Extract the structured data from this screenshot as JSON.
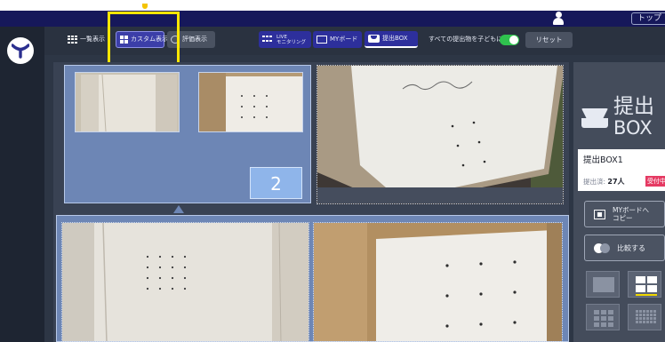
{
  "header": {
    "top_button": "トップ"
  },
  "toolbar": {
    "list_view_label": "一覧表示",
    "custom_view_label": "カスタム表示",
    "evaluation_view_label": "評価表示",
    "live_label_line1": "LIVE",
    "live_label_line2": "モニタリング",
    "myboard_label": "MYボード",
    "submit_box_label": "提出BOX",
    "publish_all_label": "すべての提出物を子どもに公開",
    "publish_all_enabled": true,
    "reset_label": "リセット"
  },
  "main": {
    "group_count": "2"
  },
  "side_panel": {
    "title_line1": "提出",
    "title_line2": "BOX",
    "box_name": "提出BOX1",
    "submitted_label": "提出済:",
    "submitted_count": "27人",
    "status_label": "受付中",
    "copy_button_line1": "MYボードへ",
    "copy_button_line2": "コピー",
    "compare_button": "比較する"
  },
  "colors": {
    "accent_blue": "#2d2f9c",
    "toggle_on": "#2fc24e",
    "status_red": "#e53a63",
    "highlight_yellow": "#ffe600"
  }
}
